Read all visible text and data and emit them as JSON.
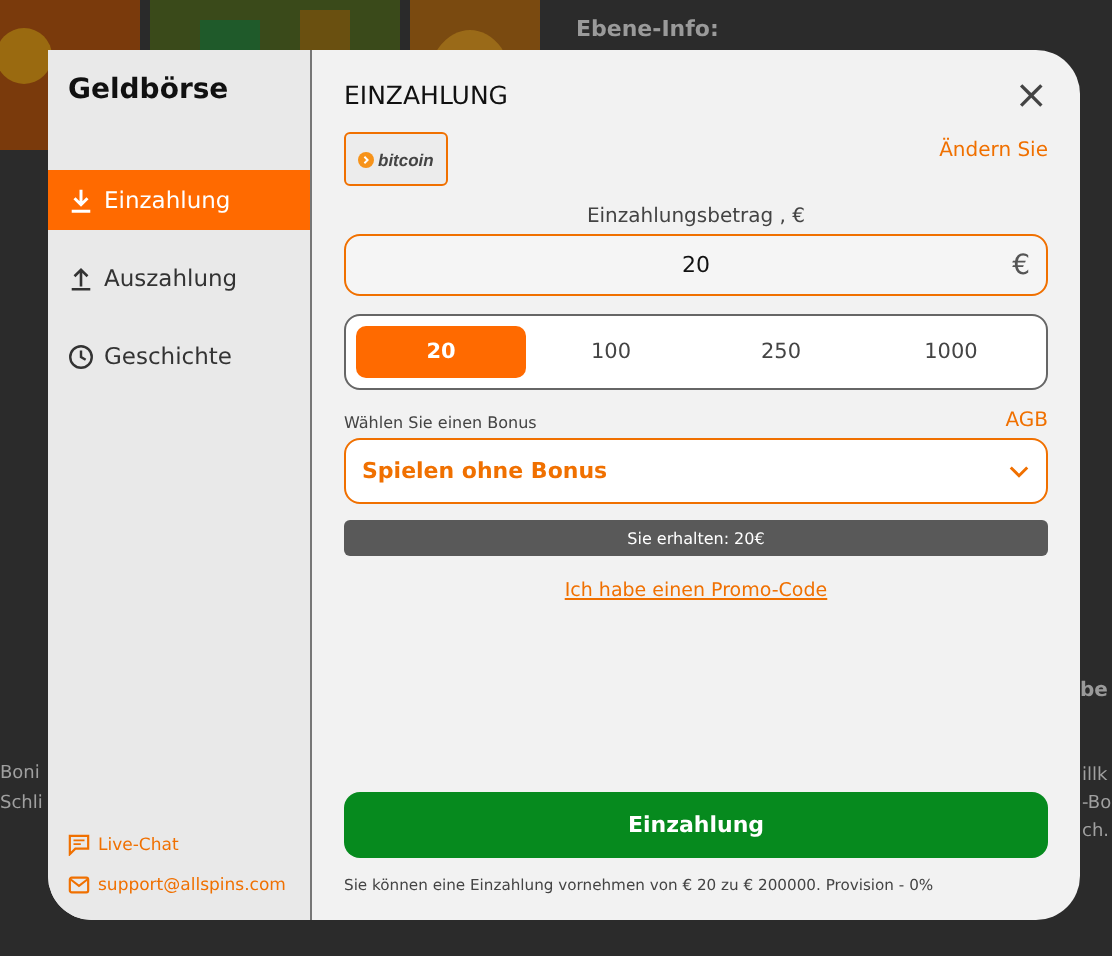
{
  "backdrop": {
    "heading": "Ebene-Info:",
    "left_text": [
      "Boni",
      "Schli"
    ],
    "right_heading": "be",
    "right_text": [
      "illk",
      "-Bo",
      "ch."
    ]
  },
  "wallet": {
    "title": "Geldbörse",
    "nav": [
      {
        "label": "Einzahlung",
        "selected": true
      },
      {
        "label": "Auszahlung",
        "selected": false
      },
      {
        "label": "Geschichte",
        "selected": false
      }
    ],
    "contacts": [
      {
        "label": "Live-Chat"
      },
      {
        "label": "support@allspins.com"
      }
    ]
  },
  "deposit": {
    "title": "EINZAHLUNG",
    "close": "×",
    "method": "bitcoin",
    "change_link": "Ändern Sie",
    "amount_label": "Einzahlungsbetrag , €",
    "amount_value": "20",
    "currency": "€",
    "presets": [
      {
        "label": "20",
        "selected": true
      },
      {
        "label": "100",
        "selected": false
      },
      {
        "label": "250",
        "selected": false
      },
      {
        "label": "1000",
        "selected": false
      }
    ],
    "bonus_label": "Wählen Sie einen Bonus",
    "terms_link": "AGB",
    "bonus_value": "Spielen ohne Bonus",
    "receive": "Sie erhalten: 20€",
    "promo_link": "Ich habe einen Promo-Code",
    "submit": "Einzahlung",
    "note": "Sie können eine Einzahlung vornehmen von € 20 zu € 200000. Provision - 0%"
  }
}
